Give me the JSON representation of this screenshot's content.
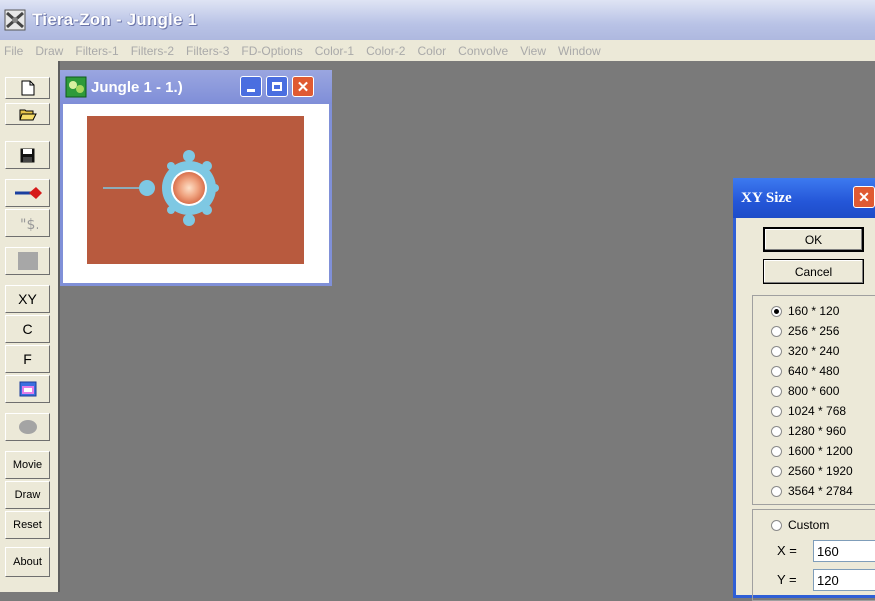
{
  "app": {
    "title": "Tiera-Zon - Jungle 1"
  },
  "menu": [
    "File",
    "Draw",
    "Filters-1",
    "Filters-2",
    "Filters-3",
    "FD-Options",
    "Color-1",
    "Color-2",
    "Color",
    "Convolve",
    "View",
    "Window"
  ],
  "toolbar": {
    "xy_label": "XY",
    "c_label": "C",
    "f_label": "F",
    "movie_label": "Movie",
    "draw_label": "Draw",
    "reset_label": "Reset",
    "about_label": "About"
  },
  "child_window": {
    "title": "Jungle 1 - 1.)"
  },
  "dialog": {
    "title": "XY Size",
    "ok_label": "OK",
    "cancel_label": "Cancel",
    "sizes": [
      "160 * 120",
      "256 * 256",
      "320 * 240",
      "640 * 480",
      "800 * 600",
      "1024 * 768",
      "1280 * 960",
      "1600 * 1200",
      "2560 * 1920",
      "3564 * 2784"
    ],
    "selected_size": "160 * 120",
    "custom_label": "Custom",
    "x_label": "X =",
    "y_label": "Y =",
    "x_value": "160",
    "y_value": "120"
  },
  "colors": {
    "fractal_bg": "#b85a3e",
    "fractal_set": "#7ec8e3",
    "dialog_title": "#2456d8"
  }
}
